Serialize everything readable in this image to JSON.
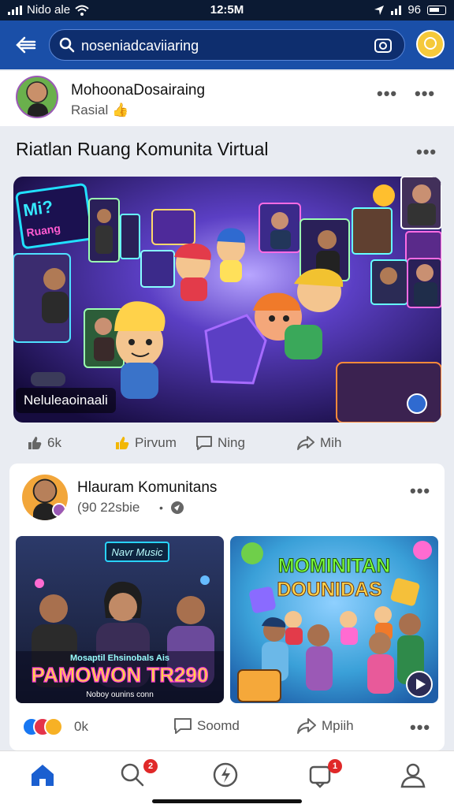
{
  "status": {
    "carrier": "Nido ale",
    "time": "12:5M",
    "battery": "96"
  },
  "search": {
    "query": "noseniadcaviiaring"
  },
  "post1": {
    "author": "MohoonaDosairaing",
    "subtitle": "Rasial 👍"
  },
  "section": {
    "title": "Riatlan Ruang Komunita Virtual"
  },
  "hero": {
    "label": "Neluleaoinaali",
    "sign_line1": "Mi?",
    "sign_line2": "Ruang"
  },
  "actions1": {
    "like": "6k",
    "share": "Pirvum",
    "comment": "Ning",
    "send": "Mih"
  },
  "post2": {
    "author": "Hlauram Komunitans",
    "subtitle": "(90 22sbie",
    "thumb1_sign": "Navr Music",
    "thumb1_caption_small": "Mosaptil Ehsinobals Ais",
    "thumb1_caption_big": "PAMOWON TR290",
    "thumb1_caption_bottom": "Noboy ounins conn",
    "thumb2_title1": "MOMINITAN",
    "thumb2_title2": "DOUNIDAS"
  },
  "actions2": {
    "react_count": "0k",
    "comment": "Soomd",
    "share": "Mpiih"
  },
  "tabs": {
    "search_badge": "2",
    "notif_badge": "1"
  }
}
